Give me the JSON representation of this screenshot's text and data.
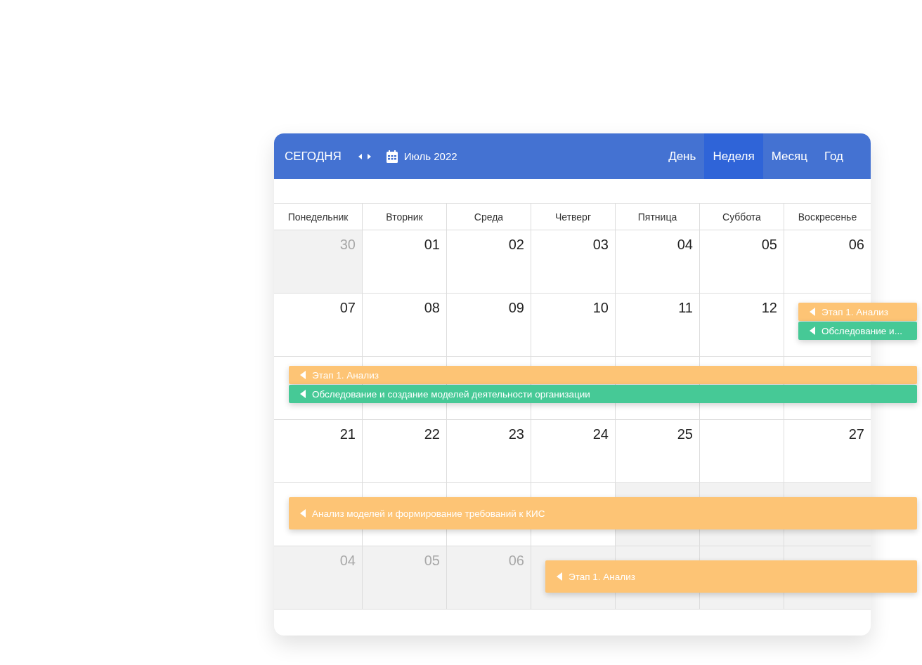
{
  "toolbar": {
    "today": "СЕГОДНЯ",
    "month": "Июль 2022"
  },
  "views": [
    {
      "label": "День",
      "selected": false
    },
    {
      "label": "Неделя",
      "selected": true
    },
    {
      "label": "Месяц",
      "selected": false
    },
    {
      "label": "Год",
      "selected": false
    }
  ],
  "weekdays": [
    "Понедельник",
    "Вторник",
    "Среда",
    "Четверг",
    "Пятница",
    "Суббота",
    "Воскресенье"
  ],
  "weeks": [
    {
      "days": [
        {
          "num": "30",
          "outside": true,
          "faded": true
        },
        {
          "num": "01",
          "outside": false,
          "faded": false
        },
        {
          "num": "02",
          "outside": false,
          "faded": false
        },
        {
          "num": "03",
          "outside": false,
          "faded": false
        },
        {
          "num": "04",
          "outside": false,
          "faded": false
        },
        {
          "num": "05",
          "outside": false,
          "faded": false
        },
        {
          "num": "06",
          "outside": false,
          "faded": false
        }
      ]
    },
    {
      "days": [
        {
          "num": "07",
          "outside": false,
          "faded": false
        },
        {
          "num": "08",
          "outside": false,
          "faded": false
        },
        {
          "num": "09",
          "outside": false,
          "faded": false
        },
        {
          "num": "10",
          "outside": false,
          "faded": false
        },
        {
          "num": "11",
          "outside": false,
          "faded": false
        },
        {
          "num": "12",
          "outside": false,
          "faded": false
        },
        {
          "outside": false,
          "events": [
            {
              "title": "Этап 1. Анализ",
              "color": "#fdc475"
            },
            {
              "title": "Обследование и...",
              "color": "#46c996"
            }
          ]
        }
      ]
    },
    {
      "days": [
        {
          "outside": false,
          "events": [
            {
              "title": "Этап 1. Анализ",
              "color": "#fdc475"
            },
            {
              "title": "Обследование и создание моделей деятельности организации",
              "color": "#46c996"
            }
          ]
        },
        {
          "outside": false
        },
        {
          "outside": false
        },
        {
          "outside": false
        },
        {
          "outside": false
        },
        {
          "outside": false
        },
        {
          "outside": false
        }
      ]
    },
    {
      "days": [
        {
          "num": "21",
          "outside": false,
          "faded": false
        },
        {
          "num": "22",
          "outside": false,
          "faded": false
        },
        {
          "num": "23",
          "outside": false,
          "faded": false
        },
        {
          "num": "24",
          "outside": false,
          "faded": false
        },
        {
          "num": "25",
          "outside": false,
          "faded": false
        },
        {
          "outside": false
        },
        {
          "num": "27",
          "outside": false,
          "faded": false
        }
      ]
    },
    {
      "days": [
        {
          "outside": false,
          "events": [
            {
              "title": "Анализ моделей и формирование требований к КИС",
              "color": "#fdc475"
            }
          ]
        },
        {
          "outside": false
        },
        {
          "outside": false
        },
        {
          "outside": false
        },
        {
          "outside": true
        },
        {
          "outside": true
        },
        {
          "outside": true
        }
      ]
    },
    {
      "days": [
        {
          "num": "04",
          "outside": true,
          "faded": true
        },
        {
          "num": "05",
          "outside": true,
          "faded": true
        },
        {
          "num": "06",
          "outside": true,
          "faded": true
        },
        {
          "outside": true,
          "events": [
            {
              "title": "Этап 1. Анализ",
              "color": "#fdc475"
            }
          ]
        },
        {
          "outside": true
        },
        {
          "outside": true
        },
        {
          "outside": true
        }
      ]
    }
  ]
}
